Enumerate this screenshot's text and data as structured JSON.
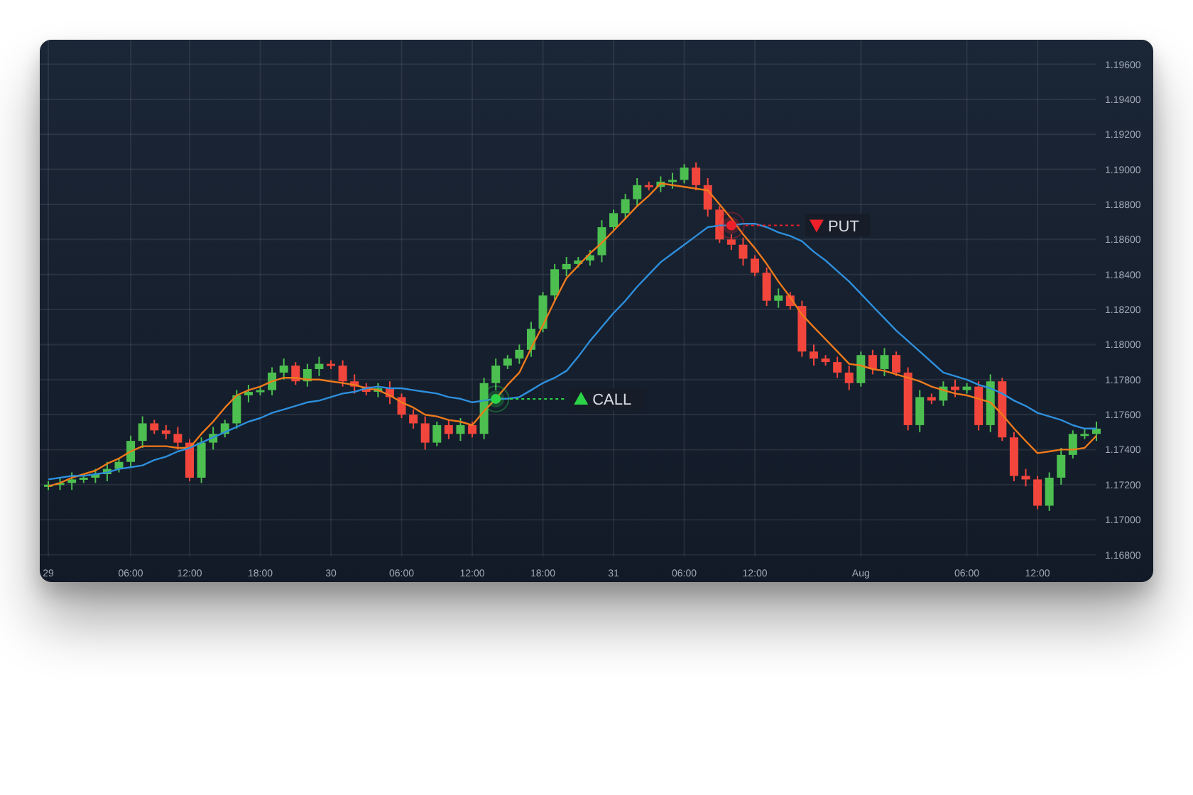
{
  "chart": {
    "chart_data": {
      "type": "candlestick",
      "grid": true,
      "ylim": [
        1.1679,
        1.1974
      ],
      "yticks": [
        {
          "value": 1.196,
          "label": "1.19600"
        },
        {
          "value": 1.194,
          "label": "1.19400"
        },
        {
          "value": 1.192,
          "label": "1.19200"
        },
        {
          "value": 1.19,
          "label": "1.19000"
        },
        {
          "value": 1.188,
          "label": "1.18800"
        },
        {
          "value": 1.186,
          "label": "1.18600"
        },
        {
          "value": 1.184,
          "label": "1.18400"
        },
        {
          "value": 1.182,
          "label": "1.18200"
        },
        {
          "value": 1.18,
          "label": "1.18000"
        },
        {
          "value": 1.178,
          "label": "1.17800"
        },
        {
          "value": 1.176,
          "label": "1.17600"
        },
        {
          "value": 1.174,
          "label": "1.17400"
        },
        {
          "value": 1.172,
          "label": "1.17200"
        },
        {
          "value": 1.17,
          "label": "1.17000"
        },
        {
          "value": 1.168,
          "label": "1.16800"
        }
      ],
      "categories": [
        "29",
        null,
        null,
        null,
        null,
        null,
        null,
        "06:00",
        null,
        null,
        null,
        null,
        "12:00",
        null,
        null,
        null,
        null,
        null,
        "18:00",
        null,
        null,
        null,
        null,
        null,
        "30",
        null,
        null,
        null,
        null,
        null,
        "06:00",
        null,
        null,
        null,
        null,
        null,
        "12:00",
        null,
        null,
        null,
        null,
        null,
        "18:00",
        null,
        null,
        null,
        null,
        null,
        "31",
        null,
        null,
        null,
        null,
        null,
        "06:00",
        null,
        null,
        null,
        null,
        null,
        "12:00",
        null,
        null,
        null,
        null,
        null,
        null,
        null,
        null,
        "Aug",
        null,
        null,
        null,
        null,
        null,
        null,
        null,
        null,
        "06:00",
        null,
        null,
        null,
        null,
        null,
        "12:00",
        null,
        null,
        null,
        null,
        null
      ],
      "ohlc": [
        [
          1.1719,
          1.1722,
          1.1717,
          1.172
        ],
        [
          1.172,
          1.1724,
          1.1717,
          1.1721
        ],
        [
          1.1721,
          1.1727,
          1.1717,
          1.1723
        ],
        [
          1.1723,
          1.1726,
          1.1721,
          1.1724
        ],
        [
          1.1724,
          1.1729,
          1.1721,
          1.1726
        ],
        [
          1.1726,
          1.1733,
          1.1722,
          1.1729
        ],
        [
          1.1729,
          1.1735,
          1.1727,
          1.1733
        ],
        [
          1.1733,
          1.1748,
          1.173,
          1.1745
        ],
        [
          1.1745,
          1.1759,
          1.1741,
          1.1755
        ],
        [
          1.1755,
          1.1757,
          1.1749,
          1.1751
        ],
        [
          1.1751,
          1.1754,
          1.1746,
          1.1749
        ],
        [
          1.1749,
          1.1753,
          1.174,
          1.1744
        ],
        [
          1.1744,
          1.1746,
          1.1722,
          1.1724
        ],
        [
          1.1724,
          1.1747,
          1.1721,
          1.1744
        ],
        [
          1.1744,
          1.1753,
          1.174,
          1.1749
        ],
        [
          1.1749,
          1.1757,
          1.1747,
          1.1755
        ],
        [
          1.1755,
          1.1774,
          1.1752,
          1.1771
        ],
        [
          1.1771,
          1.1777,
          1.1767,
          1.1773
        ],
        [
          1.1773,
          1.1776,
          1.1771,
          1.1774
        ],
        [
          1.1774,
          1.1787,
          1.1771,
          1.1784
        ],
        [
          1.1784,
          1.1792,
          1.178,
          1.1788
        ],
        [
          1.1788,
          1.179,
          1.1777,
          1.1779
        ],
        [
          1.1779,
          1.1789,
          1.1776,
          1.1786
        ],
        [
          1.1786,
          1.1793,
          1.1782,
          1.1789
        ],
        [
          1.1789,
          1.1791,
          1.1786,
          1.1788
        ],
        [
          1.1788,
          1.1791,
          1.1776,
          1.1779
        ],
        [
          1.1779,
          1.1783,
          1.1772,
          1.1776
        ],
        [
          1.1776,
          1.1778,
          1.1771,
          1.1773
        ],
        [
          1.1773,
          1.1778,
          1.177,
          1.1775
        ],
        [
          1.1775,
          1.1779,
          1.1766,
          1.177
        ],
        [
          1.177,
          1.1772,
          1.1758,
          1.176
        ],
        [
          1.176,
          1.1763,
          1.1752,
          1.1755
        ],
        [
          1.1755,
          1.1759,
          1.174,
          1.1744
        ],
        [
          1.1744,
          1.1756,
          1.1742,
          1.1754
        ],
        [
          1.1754,
          1.1757,
          1.1746,
          1.1749
        ],
        [
          1.1749,
          1.1758,
          1.1745,
          1.1754
        ],
        [
          1.1754,
          1.1756,
          1.1747,
          1.1749
        ],
        [
          1.1749,
          1.1781,
          1.1746,
          1.1778
        ],
        [
          1.1778,
          1.1792,
          1.1774,
          1.1788
        ],
        [
          1.1788,
          1.1794,
          1.1786,
          1.1792
        ],
        [
          1.1792,
          1.18,
          1.1789,
          1.1797
        ],
        [
          1.1797,
          1.1813,
          1.1793,
          1.1809
        ],
        [
          1.1809,
          1.183,
          1.1807,
          1.1828
        ],
        [
          1.1828,
          1.1846,
          1.1825,
          1.1843
        ],
        [
          1.1843,
          1.185,
          1.1839,
          1.1846
        ],
        [
          1.1846,
          1.185,
          1.1844,
          1.1848
        ],
        [
          1.1848,
          1.1854,
          1.1845,
          1.1851
        ],
        [
          1.1851,
          1.1871,
          1.1847,
          1.1867
        ],
        [
          1.1867,
          1.1877,
          1.1865,
          1.1875
        ],
        [
          1.1875,
          1.1886,
          1.1872,
          1.1883
        ],
        [
          1.1883,
          1.1895,
          1.1879,
          1.1891
        ],
        [
          1.1891,
          1.1893,
          1.1888,
          1.189
        ],
        [
          1.189,
          1.1896,
          1.1887,
          1.1893
        ],
        [
          1.1893,
          1.1898,
          1.1889,
          1.1894
        ],
        [
          1.1894,
          1.1903,
          1.1892,
          1.1901
        ],
        [
          1.1901,
          1.1904,
          1.1888,
          1.1891
        ],
        [
          1.1891,
          1.1895,
          1.1873,
          1.1877
        ],
        [
          1.1877,
          1.1879,
          1.1858,
          1.186
        ],
        [
          1.186,
          1.1863,
          1.1854,
          1.1857
        ],
        [
          1.1857,
          1.1861,
          1.1845,
          1.1849
        ],
        [
          1.1849,
          1.1851,
          1.1839,
          1.1841
        ],
        [
          1.1841,
          1.1844,
          1.1822,
          1.1825
        ],
        [
          1.1825,
          1.1832,
          1.1821,
          1.1828
        ],
        [
          1.1828,
          1.183,
          1.182,
          1.1822
        ],
        [
          1.1822,
          1.1825,
          1.1793,
          1.1796
        ],
        [
          1.1796,
          1.18,
          1.1788,
          1.1792
        ],
        [
          1.1792,
          1.1794,
          1.1788,
          1.179
        ],
        [
          1.179,
          1.1793,
          1.1781,
          1.1784
        ],
        [
          1.1784,
          1.1788,
          1.1774,
          1.1778
        ],
        [
          1.1778,
          1.1796,
          1.1776,
          1.1794
        ],
        [
          1.1794,
          1.1797,
          1.1783,
          1.1786
        ],
        [
          1.1786,
          1.1798,
          1.1782,
          1.1794
        ],
        [
          1.1794,
          1.1796,
          1.1782,
          1.1784
        ],
        [
          1.1784,
          1.1787,
          1.1751,
          1.1754
        ],
        [
          1.1754,
          1.1774,
          1.175,
          1.177
        ],
        [
          1.177,
          1.1772,
          1.1766,
          1.1768
        ],
        [
          1.1768,
          1.1779,
          1.1765,
          1.1776
        ],
        [
          1.1776,
          1.178,
          1.177,
          1.1774
        ],
        [
          1.1774,
          1.1778,
          1.1772,
          1.1776
        ],
        [
          1.1776,
          1.1779,
          1.1751,
          1.1754
        ],
        [
          1.1754,
          1.1783,
          1.175,
          1.1779
        ],
        [
          1.1779,
          1.1781,
          1.1745,
          1.1747
        ],
        [
          1.1747,
          1.175,
          1.1722,
          1.1725
        ],
        [
          1.1725,
          1.1729,
          1.1719,
          1.1723
        ],
        [
          1.1723,
          1.1725,
          1.1706,
          1.1708
        ],
        [
          1.1708,
          1.1727,
          1.1705,
          1.1724
        ],
        [
          1.1724,
          1.1741,
          1.172,
          1.1737
        ],
        [
          1.1737,
          1.1751,
          1.1735,
          1.1749
        ],
        [
          1.1749,
          1.1752,
          1.1746,
          1.1749
        ],
        [
          1.1749,
          1.1756,
          1.1745,
          1.1752
        ]
      ],
      "series": [
        {
          "type": "line",
          "color": "#ee7a1c",
          "values": [
            1.1719,
            1.1721,
            1.1724,
            1.1726,
            1.1728,
            1.1732,
            1.1735,
            1.1739,
            1.1742,
            1.1742,
            1.1742,
            1.1741,
            1.1741,
            1.1749,
            1.1756,
            1.1764,
            1.1771,
            1.1774,
            1.1776,
            1.1779,
            1.1781,
            1.1781,
            1.178,
            1.178,
            1.1779,
            1.1778,
            1.1777,
            1.1775,
            1.1774,
            1.1771,
            1.1767,
            1.1764,
            1.176,
            1.1759,
            1.1757,
            1.1756,
            1.1754,
            1.1762,
            1.1769,
            1.1777,
            1.1784,
            1.1798,
            1.1811,
            1.1825,
            1.1838,
            1.1845,
            1.1852,
            1.1858,
            1.1865,
            1.1872,
            1.1879,
            1.1885,
            1.1892,
            1.1891,
            1.189,
            1.1889,
            1.1888,
            1.188,
            1.1872,
            1.1863,
            1.1855,
            1.1846,
            1.1836,
            1.1827,
            1.1817,
            1.181,
            1.1803,
            1.1796,
            1.1789,
            1.1788,
            1.1786,
            1.1785,
            1.1783,
            1.1781,
            1.1779,
            1.1776,
            1.1774,
            1.1772,
            1.1771,
            1.1769,
            1.1767,
            1.176,
            1.1752,
            1.1745,
            1.1738,
            1.1739,
            1.174,
            1.174,
            1.1741,
            1.1748
          ]
        },
        {
          "type": "line",
          "color": "#2e8fdc",
          "values": [
            1.1723,
            1.1724,
            1.1725,
            1.1725,
            1.1726,
            1.1727,
            1.1729,
            1.173,
            1.1731,
            1.1734,
            1.1736,
            1.1739,
            1.1741,
            1.1744,
            1.1747,
            1.175,
            1.1753,
            1.1756,
            1.1758,
            1.1761,
            1.1763,
            1.1765,
            1.1767,
            1.1768,
            1.177,
            1.1772,
            1.1773,
            1.1775,
            1.1776,
            1.1775,
            1.1775,
            1.1774,
            1.1773,
            1.1772,
            1.177,
            1.1769,
            1.1767,
            1.1768,
            1.1769,
            1.1769,
            1.177,
            1.1774,
            1.1778,
            1.1781,
            1.1785,
            1.1793,
            1.1802,
            1.181,
            1.1818,
            1.1825,
            1.1833,
            1.184,
            1.1847,
            1.1852,
            1.1857,
            1.1862,
            1.1867,
            1.1868,
            1.1868,
            1.1869,
            1.1869,
            1.1867,
            1.1864,
            1.1862,
            1.1859,
            1.1853,
            1.1848,
            1.1842,
            1.1836,
            1.1829,
            1.1822,
            1.1815,
            1.1808,
            1.1802,
            1.1796,
            1.179,
            1.1784,
            1.1782,
            1.178,
            1.1777,
            1.1775,
            1.1772,
            1.1768,
            1.1765,
            1.1761,
            1.1759,
            1.1757,
            1.1754,
            1.1752,
            1.1752
          ]
        }
      ]
    },
    "signals": [
      {
        "kind": "call",
        "label": "CALL"
      },
      {
        "kind": "put",
        "label": "PUT"
      }
    ]
  }
}
